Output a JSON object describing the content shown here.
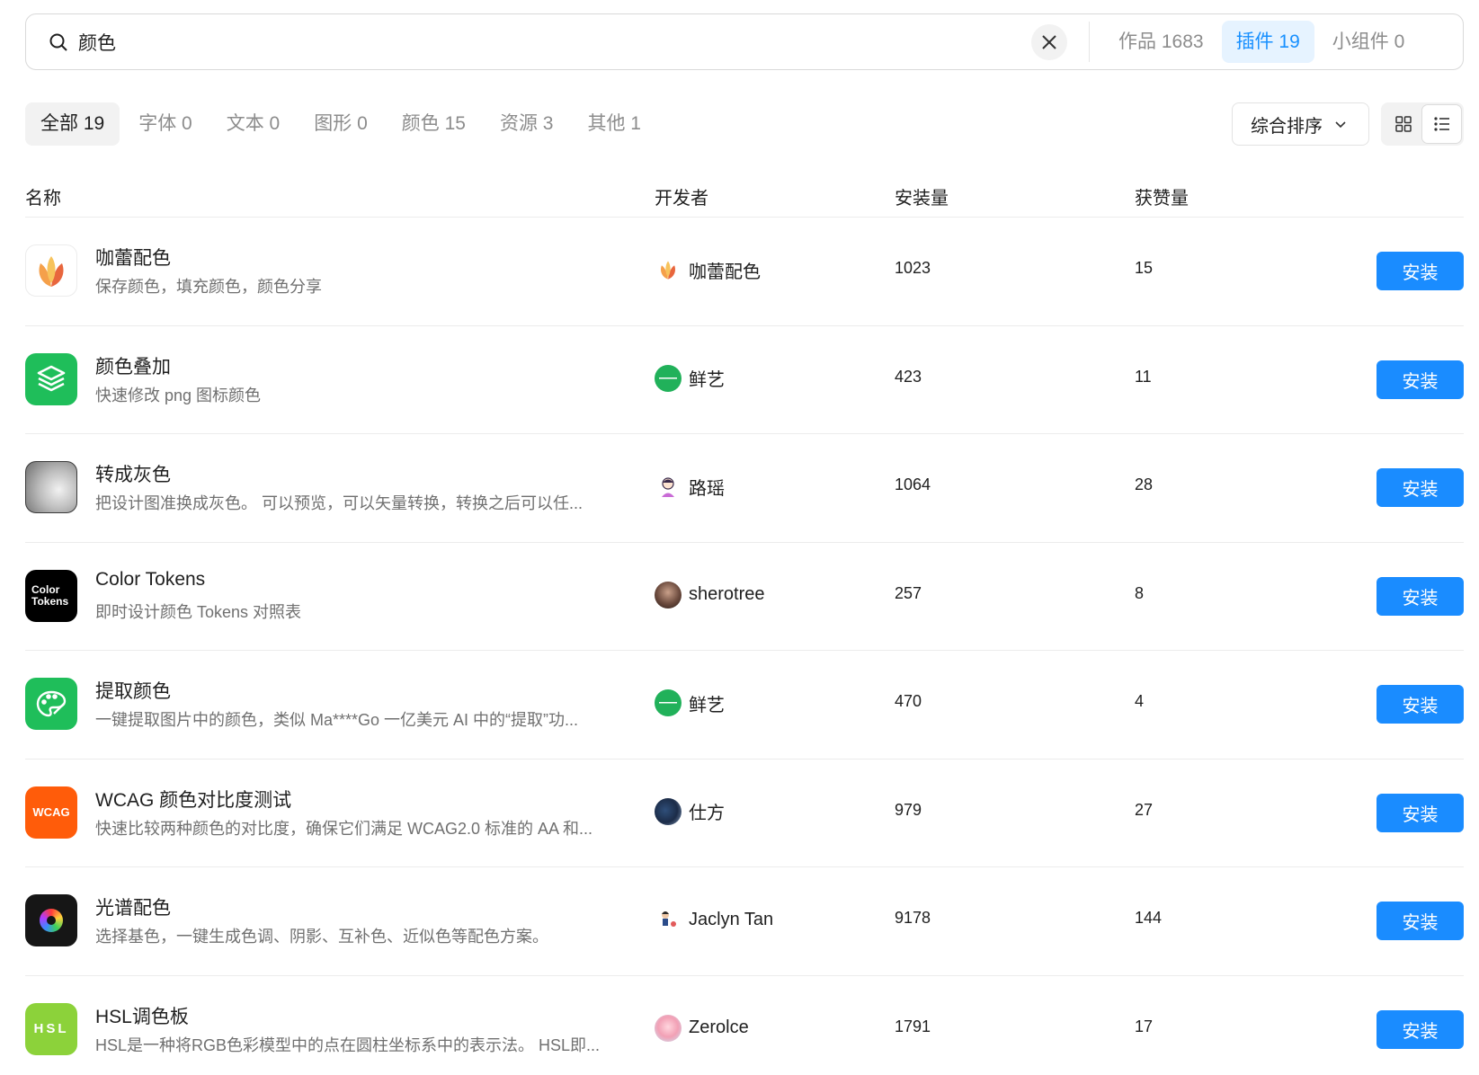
{
  "search": {
    "value": "颜色",
    "scopes": [
      {
        "label": "作品 1683",
        "active": false
      },
      {
        "label": "插件 19",
        "active": true
      },
      {
        "label": "小组件 0",
        "active": false
      }
    ]
  },
  "filters": [
    {
      "label": "全部 19",
      "active": true
    },
    {
      "label": "字体 0",
      "active": false
    },
    {
      "label": "文本 0",
      "active": false
    },
    {
      "label": "图形 0",
      "active": false
    },
    {
      "label": "颜色 15",
      "active": false
    },
    {
      "label": "资源 3",
      "active": false
    },
    {
      "label": "其他 1",
      "active": false
    }
  ],
  "sort": {
    "label": "综合排序"
  },
  "view": {
    "active": "list"
  },
  "table": {
    "headers": {
      "name": "名称",
      "developer": "开发者",
      "installs": "安装量",
      "likes": "获赞量"
    },
    "install_label": "安装",
    "rows": [
      {
        "name": "咖蕾配色",
        "desc": "保存颜色，填充颜色，颜色分享",
        "developer": "咖蕾配色",
        "installs": "1023",
        "likes": "15",
        "icon": "tulip-icon",
        "avatar": "tulip-avatar"
      },
      {
        "name": "颜色叠加",
        "desc": "快速修改 png 图标颜色",
        "developer": "鲜艺",
        "installs": "423",
        "likes": "11",
        "icon": "layers-icon",
        "avatar": "fresh-art-avatar"
      },
      {
        "name": "转成灰色",
        "desc": "把设计图准换成灰色。 可以预览，可以矢量转换，转换之后可以任...",
        "developer": "路瑶",
        "installs": "1064",
        "likes": "28",
        "icon": "gray-gradient-icon",
        "avatar": "person-avatar"
      },
      {
        "name": "Color Tokens",
        "desc": "即时设计颜色 Tokens 对照表",
        "developer": "sherotree",
        "installs": "257",
        "likes": "8",
        "icon": "color-tokens-icon",
        "icon_text": [
          "Color",
          "Tokens"
        ],
        "avatar": "photo-avatar"
      },
      {
        "name": "提取颜色",
        "desc": "一键提取图片中的颜色，类似 Ma****Go 一亿美元 AI 中的“提取”功...",
        "developer": "鲜艺",
        "installs": "470",
        "likes": "4",
        "icon": "palette-icon",
        "avatar": "fresh-art-avatar"
      },
      {
        "name": "WCAG 颜色对比度测试",
        "desc": "快速比较两种颜色的对比度，确保它们满足 WCAG2.0 标准的 AA 和...",
        "developer": "仕方",
        "installs": "979",
        "likes": "27",
        "icon": "wcag-icon",
        "icon_text": [
          "WCAG"
        ],
        "avatar": "photo-avatar"
      },
      {
        "name": "光谱配色",
        "desc": "选择基色，一键生成色调、阴影、互补色、近似色等配色方案。",
        "developer": "Jaclyn Tan",
        "installs": "9178",
        "likes": "144",
        "icon": "spectrum-icon",
        "avatar": "person-avatar"
      },
      {
        "name": "HSL调色板",
        "desc": "HSL是一种将RGB色彩模型中的点在圆柱坐标系中的表示法。 HSL即...",
        "developer": "Zerolce",
        "installs": "1791",
        "likes": "17",
        "icon": "hsl-icon",
        "icon_text": [
          "HSL"
        ],
        "avatar": "photo-avatar"
      }
    ]
  },
  "colors": {
    "accent": "#1a8cff",
    "active_tab_bg": "#e6f3ff",
    "active_tab_text": "#1890ff"
  }
}
